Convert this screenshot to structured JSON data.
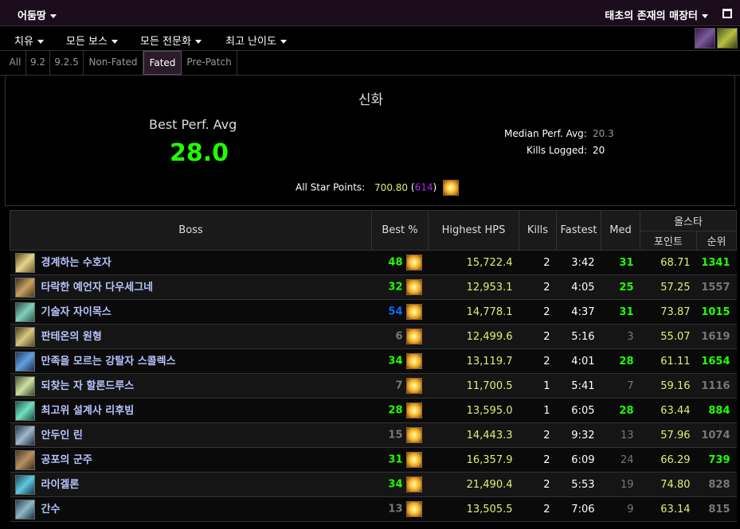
{
  "topbar": {
    "zone": "어둠땅",
    "character": "태초의 존재의 매장터"
  },
  "menus": [
    {
      "label": "치유"
    },
    {
      "label": "모든 보스"
    },
    {
      "label": "모든 전문화"
    },
    {
      "label": "최고 난이도"
    }
  ],
  "tabs": [
    {
      "label": "All",
      "active": false
    },
    {
      "label": "9.2",
      "active": false
    },
    {
      "label": "9.2.5",
      "active": false
    },
    {
      "label": "Non-Fated",
      "active": false
    },
    {
      "label": "Fated",
      "active": true
    },
    {
      "label": "Pre-Patch",
      "active": false
    }
  ],
  "summary": {
    "difficulty": "신화",
    "best_perf_label": "Best Perf. Avg",
    "best_perf_value": "28.0",
    "median_label": "Median Perf. Avg:",
    "median_value": "20.3",
    "kills_label": "Kills Logged:",
    "kills_value": "20",
    "star_label": "All Star Points:",
    "star_points": "700.80",
    "star_rank_open": "(",
    "star_rank": "614",
    "star_rank_close": ")"
  },
  "table": {
    "headers": {
      "boss": "Boss",
      "best": "Best %",
      "hps": "Highest HPS",
      "kills": "Kills",
      "fastest": "Fastest",
      "med": "Med",
      "allstar": "올스타",
      "points": "포인트",
      "rank": "순위"
    },
    "rows": [
      {
        "boss": "경계하는 수호자",
        "best": "48",
        "best_color": "green",
        "hps": "15,722.4",
        "kills": "2",
        "fastest": "3:42",
        "med": "31",
        "med_color": "green",
        "points": "68.71",
        "rank": "1341",
        "rank_color": "green"
      },
      {
        "boss": "타락한 예언자 다우세그네",
        "best": "32",
        "best_color": "green",
        "hps": "12,953.1",
        "kills": "2",
        "fastest": "4:05",
        "med": "25",
        "med_color": "green",
        "points": "57.25",
        "rank": "1557",
        "rank_color": "gray"
      },
      {
        "boss": "기술자 자이목스",
        "best": "54",
        "best_color": "blue",
        "hps": "14,778.1",
        "kills": "2",
        "fastest": "4:37",
        "med": "31",
        "med_color": "green",
        "points": "73.87",
        "rank": "1015",
        "rank_color": "green"
      },
      {
        "boss": "판테온의 원형",
        "best": "6",
        "best_color": "gray",
        "hps": "12,499.6",
        "kills": "2",
        "fastest": "5:16",
        "med": "3",
        "med_color": "gray",
        "points": "55.07",
        "rank": "1619",
        "rank_color": "gray"
      },
      {
        "boss": "만족을 모르는 강탈자 스콜렉스",
        "best": "34",
        "best_color": "green",
        "hps": "13,119.7",
        "kills": "2",
        "fastest": "4:01",
        "med": "28",
        "med_color": "green",
        "points": "61.11",
        "rank": "1654",
        "rank_color": "green"
      },
      {
        "boss": "되찾는 자 할론드루스",
        "best": "7",
        "best_color": "gray",
        "hps": "11,700.5",
        "kills": "1",
        "fastest": "5:41",
        "med": "7",
        "med_color": "gray",
        "points": "59.16",
        "rank": "1116",
        "rank_color": "gray"
      },
      {
        "boss": "최고위 설계사 리후빔",
        "best": "28",
        "best_color": "green",
        "hps": "13,595.0",
        "kills": "1",
        "fastest": "6:05",
        "med": "28",
        "med_color": "green",
        "points": "63.44",
        "rank": "884",
        "rank_color": "green"
      },
      {
        "boss": "안두인 린",
        "best": "15",
        "best_color": "gray",
        "hps": "14,443.3",
        "kills": "2",
        "fastest": "9:32",
        "med": "13",
        "med_color": "gray",
        "points": "57.96",
        "rank": "1074",
        "rank_color": "gray"
      },
      {
        "boss": "공포의 군주",
        "best": "31",
        "best_color": "green",
        "hps": "16,357.9",
        "kills": "2",
        "fastest": "6:09",
        "med": "24",
        "med_color": "gray",
        "points": "66.29",
        "rank": "739",
        "rank_color": "green"
      },
      {
        "boss": "라이겔론",
        "best": "34",
        "best_color": "green",
        "hps": "21,490.4",
        "kills": "2",
        "fastest": "5:53",
        "med": "19",
        "med_color": "gray",
        "points": "74.80",
        "rank": "828",
        "rank_color": "gray"
      },
      {
        "boss": "간수",
        "best": "13",
        "best_color": "gray",
        "hps": "13,505.5",
        "kills": "2",
        "fastest": "7:06",
        "med": "9",
        "med_color": "gray",
        "points": "63.14",
        "rank": "815",
        "rank_color": "gray"
      }
    ]
  },
  "colors": {
    "green": "#1eff00",
    "blue": "#0070ff",
    "gray": "#777777",
    "hps": "#d6f56d",
    "boss_name": "#b8c4ff",
    "star_rank": "#a335ee"
  }
}
